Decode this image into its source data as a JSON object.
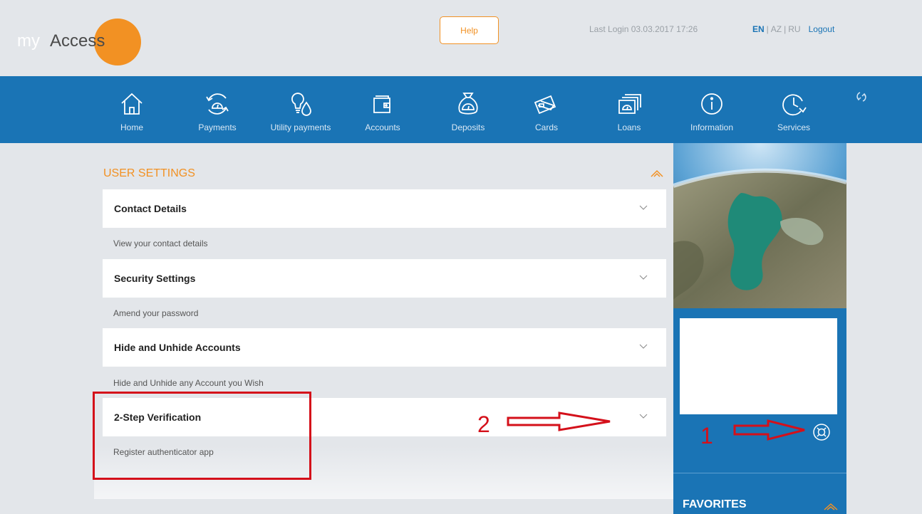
{
  "header": {
    "logo_my": "my",
    "logo_access": "Access",
    "help_label": "Help",
    "last_login": "Last Login 03.03.2017 17:26",
    "languages": {
      "en": "EN",
      "sep1": "|",
      "az": "AZ",
      "sep2": "|",
      "ru": "RU"
    },
    "logout_label": "Logout"
  },
  "nav": {
    "items": [
      {
        "label": "Home",
        "icon": "home-icon"
      },
      {
        "label": "Payments",
        "icon": "payments-icon"
      },
      {
        "label": "Utility payments",
        "icon": "utility-icon"
      },
      {
        "label": "Accounts",
        "icon": "wallet-icon"
      },
      {
        "label": "Deposits",
        "icon": "money-bag-icon"
      },
      {
        "label": "Cards",
        "icon": "cards-icon"
      },
      {
        "label": "Loans",
        "icon": "loans-icon"
      },
      {
        "label": "Information",
        "icon": "info-icon"
      },
      {
        "label": "Services",
        "icon": "services-icon"
      }
    ],
    "refresh_icon": "refresh-icon"
  },
  "settings": {
    "title": "USER SETTINGS",
    "rows": [
      {
        "label": "Contact Details",
        "desc": "View your contact details"
      },
      {
        "label": "Security Settings",
        "desc": "Amend your password"
      },
      {
        "label": "Hide and Unhide Accounts",
        "desc": "Hide and Unhide any Account you Wish"
      },
      {
        "label": "2-Step Verification",
        "desc": "Register authenticator app"
      }
    ]
  },
  "sidebar": {
    "favorites_label": "FAVORITES"
  },
  "annotations": {
    "one": "1",
    "two": "2"
  },
  "colors": {
    "brand_blue": "#1a74b5",
    "brand_orange": "#f29123",
    "annotation_red": "#d4101a",
    "page_bg": "#e3e6ea"
  }
}
